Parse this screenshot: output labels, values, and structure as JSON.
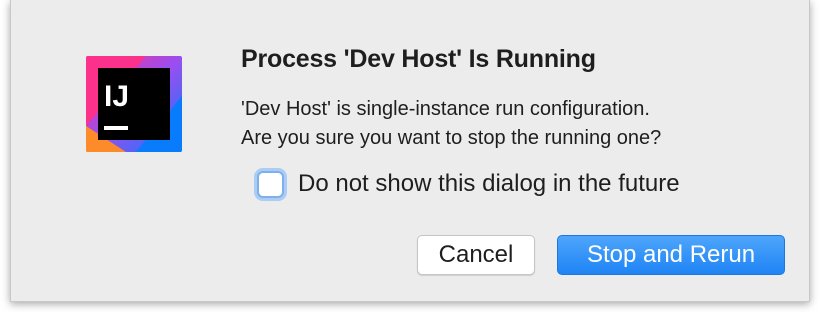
{
  "dialog": {
    "title": "Process 'Dev Host' Is Running",
    "message_line1": "'Dev Host' is single-instance run configuration.",
    "message_line2": "Are you sure you want to stop the running one?",
    "checkbox_label": "Do not show this dialog in the future",
    "checkbox_checked": false,
    "cancel_label": "Cancel",
    "primary_label": "Stop and Rerun"
  },
  "app_icon": {
    "name": "intellij-idea-icon",
    "text": "IJ"
  },
  "colors": {
    "dialog_bg": "#ececec",
    "primary_button": "#1f84f5",
    "checkbox_focus": "#a9cdf6"
  }
}
